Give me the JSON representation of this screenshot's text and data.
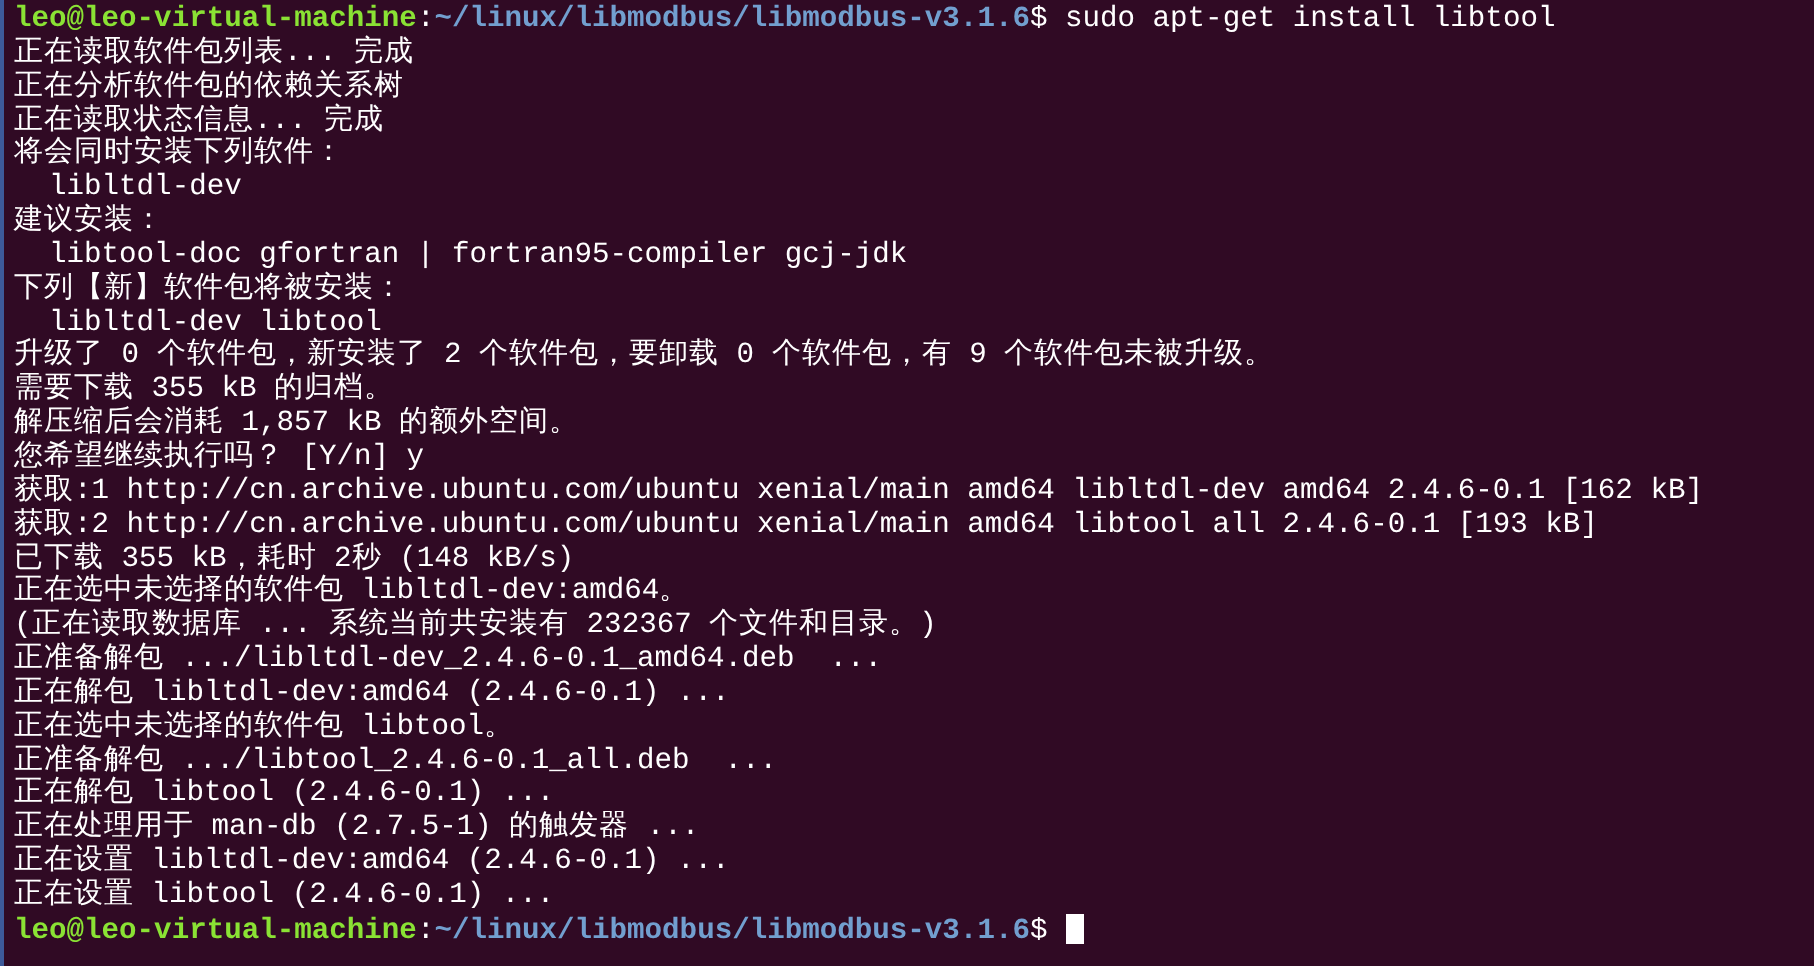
{
  "terminal": {
    "lines": [
      {
        "kind": "prompt",
        "user": "leo@leo-virtual-machine",
        "separator": ":",
        "path": "~/linux/libmodbus/libmodbus-v3.1.6",
        "symbol": "$",
        "command": "sudo apt-get install libtool",
        "cursor": false
      },
      {
        "kind": "output",
        "text": "正在读取软件包列表... 完成"
      },
      {
        "kind": "output",
        "text": "正在分析软件包的依赖关系树"
      },
      {
        "kind": "output",
        "text": "正在读取状态信息... 完成"
      },
      {
        "kind": "output",
        "text": "将会同时安装下列软件："
      },
      {
        "kind": "output",
        "text": "  libltdl-dev"
      },
      {
        "kind": "output",
        "text": "建议安装："
      },
      {
        "kind": "output",
        "text": "  libtool-doc gfortran | fortran95-compiler gcj-jdk"
      },
      {
        "kind": "output",
        "text": "下列【新】软件包将被安装："
      },
      {
        "kind": "output",
        "text": "  libltdl-dev libtool"
      },
      {
        "kind": "output",
        "text": "升级了 0 个软件包，新安装了 2 个软件包，要卸载 0 个软件包，有 9 个软件包未被升级。"
      },
      {
        "kind": "output",
        "text": "需要下载 355 kB 的归档。"
      },
      {
        "kind": "output",
        "text": "解压缩后会消耗 1,857 kB 的额外空间。"
      },
      {
        "kind": "output",
        "text": "您希望继续执行吗？ [Y/n] y"
      },
      {
        "kind": "output",
        "text": "获取:1 http://cn.archive.ubuntu.com/ubuntu xenial/main amd64 libltdl-dev amd64 2.4.6-0.1 [162 kB]"
      },
      {
        "kind": "output",
        "text": "获取:2 http://cn.archive.ubuntu.com/ubuntu xenial/main amd64 libtool all 2.4.6-0.1 [193 kB]"
      },
      {
        "kind": "output",
        "text": "已下载 355 kB，耗时 2秒 (148 kB/s)"
      },
      {
        "kind": "output",
        "text": "正在选中未选择的软件包 libltdl-dev:amd64。"
      },
      {
        "kind": "output",
        "text": "(正在读取数据库 ... 系统当前共安装有 232367 个文件和目录。)"
      },
      {
        "kind": "output",
        "text": "正准备解包 .../libltdl-dev_2.4.6-0.1_amd64.deb  ..."
      },
      {
        "kind": "output",
        "text": "正在解包 libltdl-dev:amd64 (2.4.6-0.1) ..."
      },
      {
        "kind": "output",
        "text": "正在选中未选择的软件包 libtool。"
      },
      {
        "kind": "output",
        "text": "正准备解包 .../libtool_2.4.6-0.1_all.deb  ..."
      },
      {
        "kind": "output",
        "text": "正在解包 libtool (2.4.6-0.1) ..."
      },
      {
        "kind": "output",
        "text": "正在处理用于 man-db (2.7.5-1) 的触发器 ..."
      },
      {
        "kind": "output",
        "text": "正在设置 libltdl-dev:amd64 (2.4.6-0.1) ..."
      },
      {
        "kind": "output",
        "text": "正在设置 libtool (2.4.6-0.1) ..."
      },
      {
        "kind": "prompt",
        "user": "leo@leo-virtual-machine",
        "separator": ":",
        "path": "~/linux/libmodbus/libmodbus-v3.1.6",
        "symbol": "$",
        "cursor": true
      }
    ]
  }
}
